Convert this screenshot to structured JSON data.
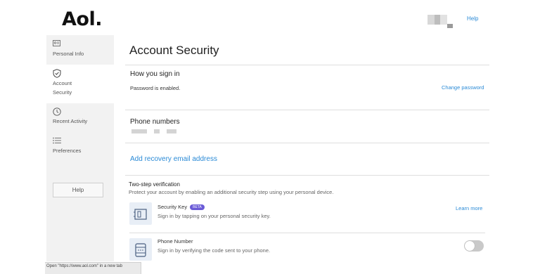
{
  "brand": {
    "logo": "Aol."
  },
  "header": {
    "help_label": "Help"
  },
  "sidebar": {
    "items": [
      {
        "label": "Personal Info",
        "icon": "id-card-icon"
      },
      {
        "label_line1": "Account",
        "label_line2": "Security",
        "icon": "shield-check-icon"
      },
      {
        "label": "Recent Activity",
        "icon": "clock-icon"
      },
      {
        "label": "Preferences",
        "icon": "list-icon"
      }
    ],
    "help_button": "Help"
  },
  "main": {
    "title": "Account Security",
    "sign_in": {
      "heading": "How you sign in",
      "status": "Password is enabled.",
      "change_password": "Change password"
    },
    "phone": {
      "heading": "Phone numbers"
    },
    "recovery": {
      "add_email": "Add recovery email address"
    },
    "two_step": {
      "heading": "Two-step verification",
      "description": "Protect your account by enabling an additional security step using your personal device.",
      "security_key": {
        "title": "Security Key",
        "badge": "BETA",
        "description": "Sign in by tapping on your personal security key.",
        "learn_more": "Learn more"
      },
      "phone_number": {
        "title": "Phone Number",
        "description": "Sign in by verifying the code sent to your phone.",
        "enabled": false
      }
    }
  },
  "status_bar": {
    "text": "Open \"https://www.aol.com\" in a new tab"
  },
  "colors": {
    "accent": "#2a8ad6",
    "badge": "#6a5bd7",
    "sidebar_bg": "#f2f2f2"
  }
}
